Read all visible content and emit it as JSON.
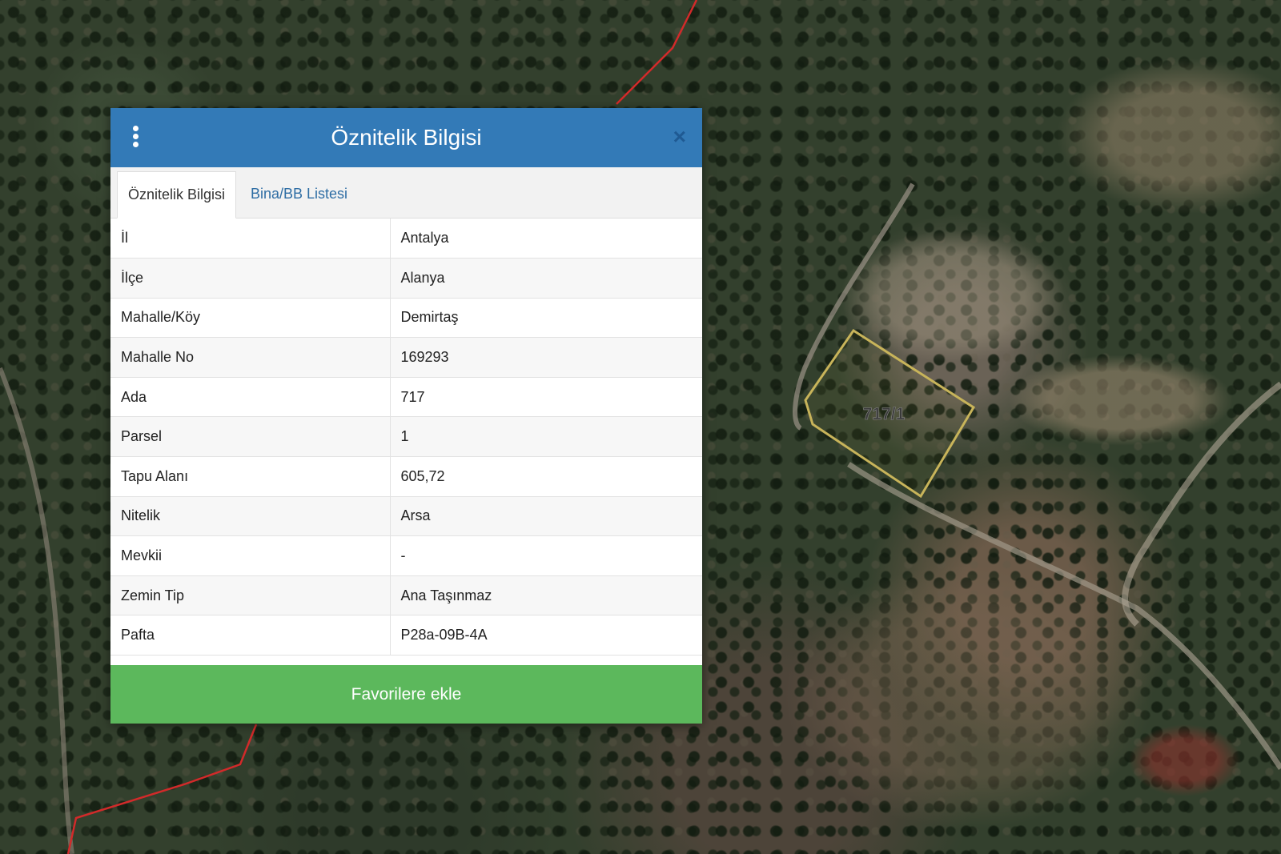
{
  "dialog": {
    "title": "Öznitelik Bilgisi",
    "close_label": "×",
    "tabs": [
      {
        "label": "Öznitelik Bilgisi",
        "active": true
      },
      {
        "label": "Bina/BB Listesi",
        "active": false
      }
    ],
    "rows": [
      {
        "key": "İl",
        "value": "Antalya"
      },
      {
        "key": "İlçe",
        "value": "Alanya"
      },
      {
        "key": "Mahalle/Köy",
        "value": "Demirtaş"
      },
      {
        "key": "Mahalle No",
        "value": "169293"
      },
      {
        "key": "Ada",
        "value": "717"
      },
      {
        "key": "Parsel",
        "value": "1"
      },
      {
        "key": "Tapu Alanı",
        "value": "605,72"
      },
      {
        "key": "Nitelik",
        "value": "Arsa"
      },
      {
        "key": "Mevkii",
        "value": "-"
      },
      {
        "key": "Zemin Tip",
        "value": "Ana Taşınmaz"
      },
      {
        "key": "Pafta",
        "value": "P28a-09B-4A"
      }
    ],
    "favorite_button": "Favorilere ekle"
  },
  "map": {
    "parcel_label": "717/1",
    "parcel_color": "#c8b45a",
    "boundary_color": "#d22a2a"
  },
  "colors": {
    "header": "#337ab7",
    "button": "#5cb85c",
    "tab_link": "#2e6da4"
  }
}
